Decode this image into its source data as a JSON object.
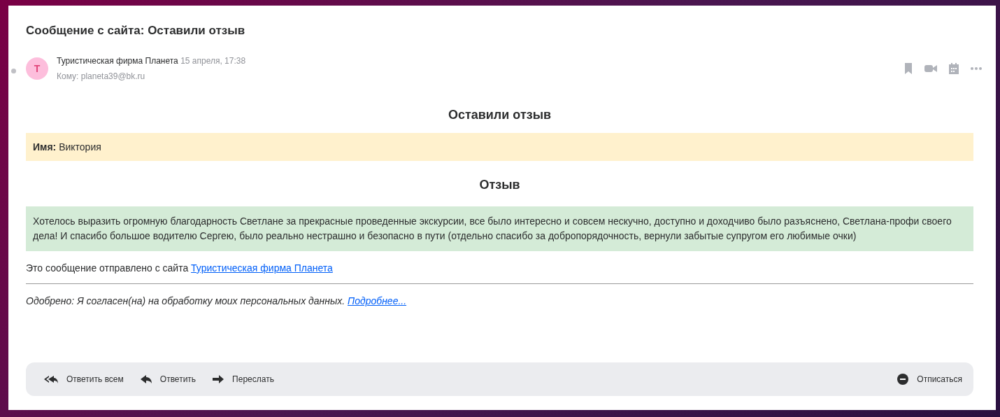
{
  "subject": "Сообщение с сайта: Оставили отзыв",
  "sender": {
    "initial": "Т",
    "name": "Туристическая фирма Планета",
    "date": "15 апреля, 17:38",
    "to": "Кому: planeta39@bk.ru"
  },
  "body": {
    "heading": "Оставили отзыв",
    "name_field": "**Имя:** Виктория",
    "review_heading": "Отзыв",
    "review": "Хотелось выразить огромную благодарность Светлане за прекрасные проведенные экскурсии, все было интересно и совсем нескучно, доступно и доходчиво было разъяснено, Светлана-профи своего дела! И спасибо большое водителю Сергею, было реально нестрашно и безопасно в пути (отдельно спасибо за добропорядочность, вернули забытые супругом его любимые очки)",
    "footer_text": "Это сообщение отправлено с сайта",
    "footer_link": "Туристическая фирма Планета",
    "consent_text": "Одобрено: Я согласен(на) на обработку моих персональных данных.",
    "consent_link": "Подробнее..."
  },
  "actions": [
    {
      "kind": "reply_all",
      "label": "Ответить всем"
    },
    {
      "kind": "reply",
      "label": "Ответить"
    },
    {
      "kind": "forward",
      "label": "Переслать"
    },
    {
      "kind": "unsubscribe",
      "label": "Отписаться"
    }
  ]
}
